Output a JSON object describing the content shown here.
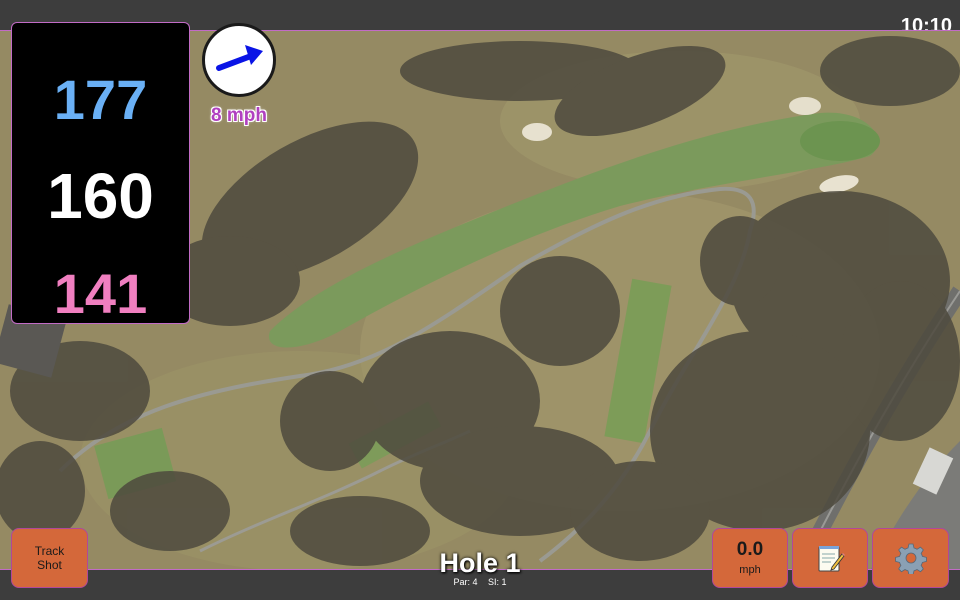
{
  "status_bar": {
    "time": "10:10"
  },
  "distances": {
    "back": "177",
    "center": "160",
    "front": "141",
    "colors": {
      "back": "#6ab0f5",
      "center": "#ffffff",
      "front": "#f07fc0"
    }
  },
  "wind": {
    "speed_label": "8 mph",
    "icon": "wind-arrow-icon",
    "arrow_color": "#0a14e6"
  },
  "hole": {
    "title": "Hole 1",
    "par": "Par: 4",
    "stroke_index": "SI: 1"
  },
  "buttons": {
    "track_shot_line1": "Track",
    "track_shot_line2": "Shot",
    "speed_value": "0.0",
    "speed_unit": "mph",
    "notes_icon": "notepad-icon",
    "settings_icon": "gear-icon",
    "accent": "#d4683a"
  }
}
